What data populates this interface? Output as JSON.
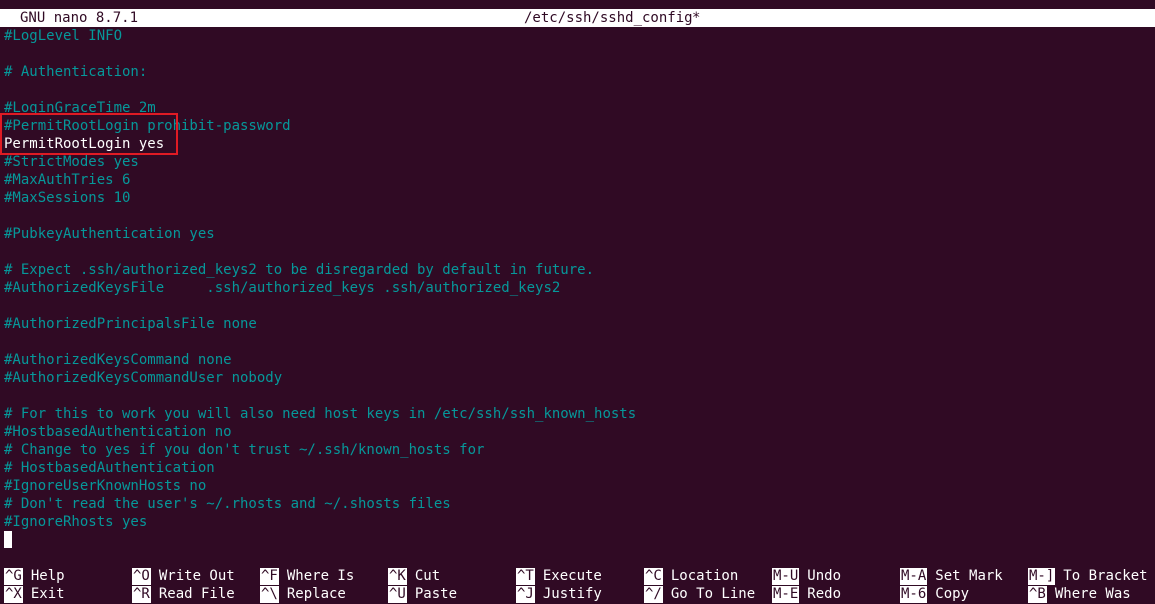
{
  "titlebar": {
    "app": "GNU nano 8.7.1",
    "file": "/etc/ssh/sshd_config",
    "modified": "*"
  },
  "editor": {
    "lines": [
      "#LogLevel INFO",
      "",
      "# Authentication:",
      "",
      "#LoginGraceTime 2m",
      "#PermitRootLogin prohibit-password",
      "PermitRootLogin yes",
      "#StrictModes yes",
      "#MaxAuthTries 6",
      "#MaxSessions 10",
      "",
      "#PubkeyAuthentication yes",
      "",
      "# Expect .ssh/authorized_keys2 to be disregarded by default in future.",
      "#AuthorizedKeysFile     .ssh/authorized_keys .ssh/authorized_keys2",
      "",
      "#AuthorizedPrincipalsFile none",
      "",
      "#AuthorizedKeysCommand none",
      "#AuthorizedKeysCommandUser nobody",
      "",
      "# For this to work you will also need host keys in /etc/ssh/ssh_known_hosts",
      "#HostbasedAuthentication no",
      "# Change to yes if you don't trust ~/.ssh/known_hosts for",
      "# HostbasedAuthentication",
      "#IgnoreUserKnownHosts no",
      "# Don't read the user's ~/.rhosts and ~/.shosts files",
      "#IgnoreRhosts yes"
    ]
  },
  "shortcuts": {
    "row1": [
      {
        "key": "^G",
        "label": "Help"
      },
      {
        "key": "^O",
        "label": "Write Out"
      },
      {
        "key": "^F",
        "label": "Where Is"
      },
      {
        "key": "^K",
        "label": "Cut"
      },
      {
        "key": "^T",
        "label": "Execute"
      },
      {
        "key": "^C",
        "label": "Location"
      },
      {
        "key": "M-U",
        "label": "Undo"
      },
      {
        "key": "M-A",
        "label": "Set Mark"
      },
      {
        "key": "M-]",
        "label": "To Bracket"
      }
    ],
    "row2": [
      {
        "key": "^X",
        "label": "Exit"
      },
      {
        "key": "^R",
        "label": "Read File"
      },
      {
        "key": "^\\",
        "label": "Replace"
      },
      {
        "key": "^U",
        "label": "Paste"
      },
      {
        "key": "^J",
        "label": "Justify"
      },
      {
        "key": "^/",
        "label": "Go To Line"
      },
      {
        "key": "M-E",
        "label": "Redo"
      },
      {
        "key": "M-6",
        "label": "Copy"
      },
      {
        "key": "^B",
        "label": "Where Was"
      }
    ]
  },
  "colors": {
    "background": "#300a24",
    "comment": "#06989a",
    "text": "#ffffff",
    "highlight": "#e01b24"
  }
}
